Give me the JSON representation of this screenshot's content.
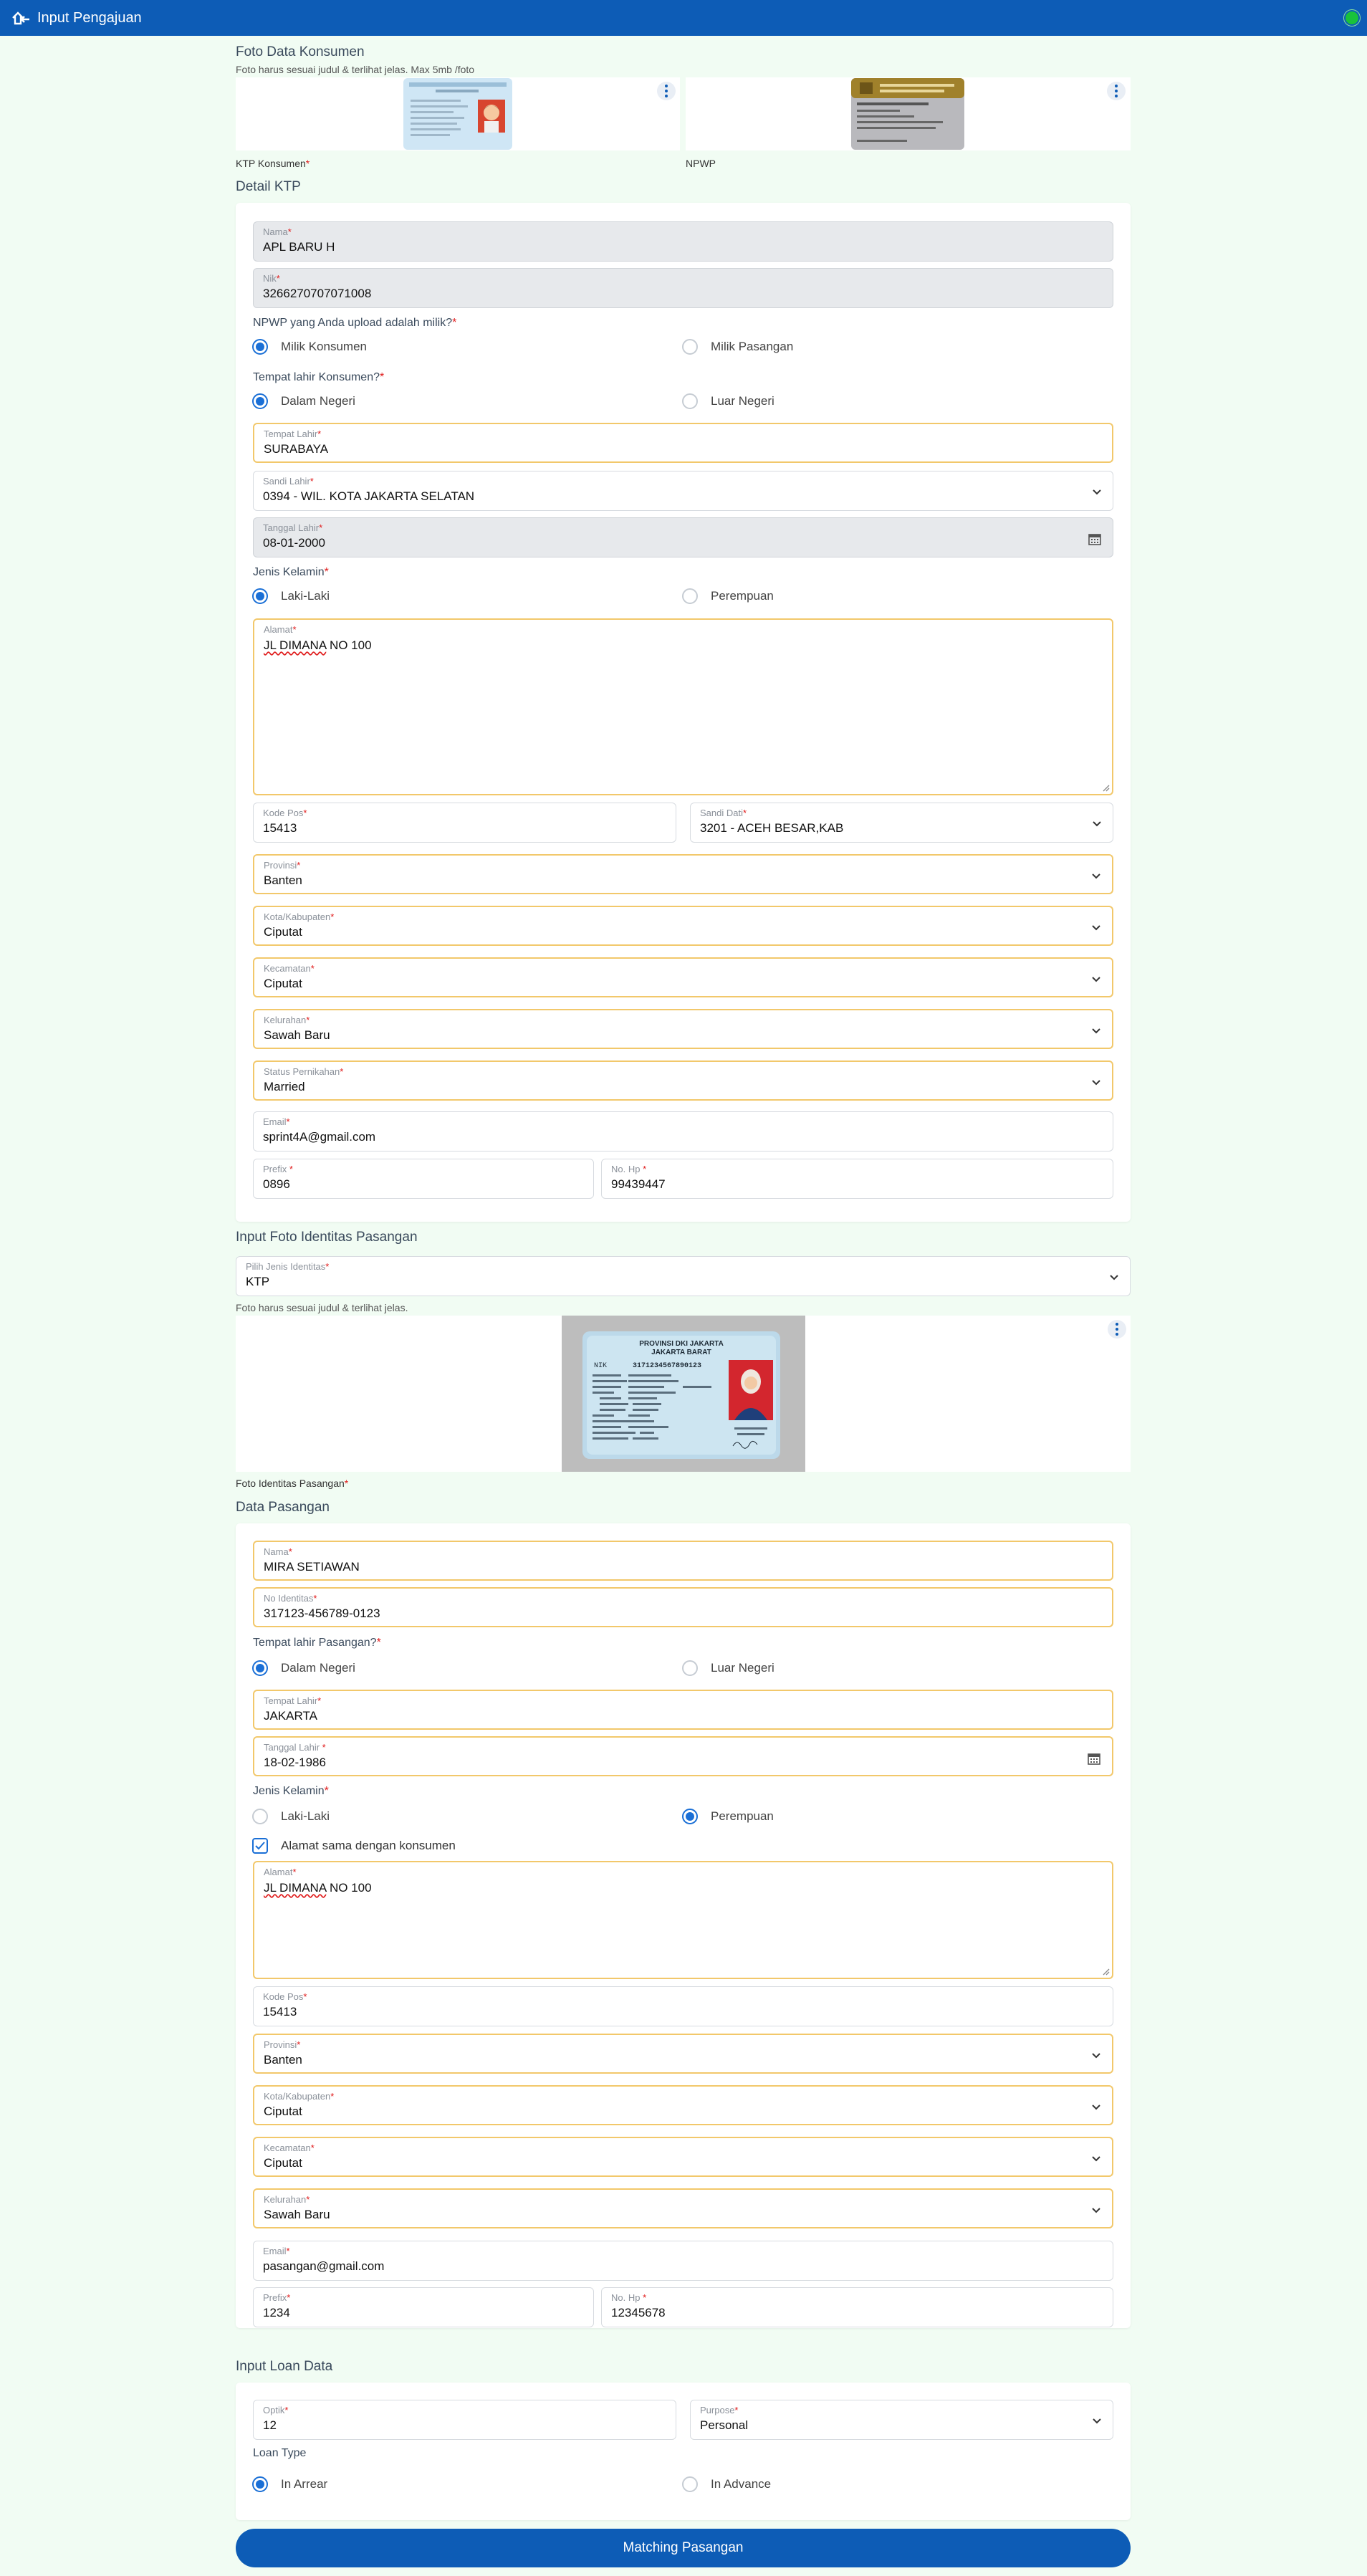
{
  "appbar": {
    "title": "Input Pengajuan"
  },
  "foto_konsumen": {
    "title": "Foto Data Konsumen",
    "hint": "Foto harus sesuai judul & terlihat jelas. Max 5mb /foto",
    "ktp_caption": "KTP Konsumen",
    "npwp_caption": "NPWP"
  },
  "detail_ktp": {
    "title": "Detail KTP",
    "nama": {
      "label": "Nama",
      "value": "APL BARU H"
    },
    "nik": {
      "label": "Nik",
      "value": "3266270707071008"
    },
    "npwp_question": "NPWP yang Anda upload adalah milik?",
    "npwp_options": [
      "Milik Konsumen",
      "Milik Pasangan"
    ],
    "tempat_question": "Tempat lahir Konsumen?",
    "tempat_options": [
      "Dalam Negeri",
      "Luar Negeri"
    ],
    "tempat_lahir": {
      "label": "Tempat Lahir",
      "value": "SURABAYA"
    },
    "sandi_lahir": {
      "label": "Sandi Lahir",
      "value": "0394 - WIL. KOTA JAKARTA SELATAN"
    },
    "tanggal_lahir": {
      "label": "Tanggal Lahir",
      "value": "08-01-2000"
    },
    "jk_question": "Jenis Kelamin",
    "jk_options": [
      "Laki-Laki",
      "Perempuan"
    ],
    "alamat": {
      "label": "Alamat",
      "value_a": "JL DIMANA",
      "value_b": " NO 100"
    },
    "kode_pos": {
      "label": "Kode Pos",
      "value": "15413"
    },
    "sandi_dati": {
      "label": "Sandi Dati",
      "value": "3201 - ACEH BESAR,KAB"
    },
    "provinsi": {
      "label": "Provinsi",
      "value": "Banten"
    },
    "kota": {
      "label": "Kota/Kabupaten",
      "value": "Ciputat"
    },
    "kecamatan": {
      "label": "Kecamatan",
      "value": "Ciputat"
    },
    "kelurahan": {
      "label": "Kelurahan",
      "value": "Sawah Baru"
    },
    "status": {
      "label": "Status Pernikahan",
      "value": "Married"
    },
    "email": {
      "label": "Email",
      "value": "sprint4A@gmail.com"
    },
    "prefix": {
      "label": "Prefix",
      "value": "0896"
    },
    "nohp": {
      "label": "No. Hp",
      "value": "99439447"
    }
  },
  "foto_pasangan": {
    "title": "Input Foto Identitas Pasangan",
    "jenis": {
      "label": "Pilih Jenis Identitas",
      "value": "KTP"
    },
    "hint": "Foto harus sesuai judul & terlihat jelas.",
    "caption": "Foto Identitas Pasangan",
    "card_title_1": "PROVINSI DKI JAKARTA",
    "card_title_2": "JAKARTA BARAT",
    "card_nik": "3171234567890123"
  },
  "data_pasangan": {
    "title": "Data Pasangan",
    "nama": {
      "label": "Nama",
      "value": "MIRA SETIAWAN"
    },
    "no_id": {
      "label": "No Identitas",
      "value": "317123-456789-0123"
    },
    "tempat_question": "Tempat lahir Pasangan?",
    "tempat_options": [
      "Dalam Negeri",
      "Luar Negeri"
    ],
    "tempat_lahir": {
      "label": "Tempat Lahir",
      "value": "JAKARTA"
    },
    "tanggal_lahir": {
      "label": "Tanggal Lahir",
      "value": "18-02-1986"
    },
    "jk_question": "Jenis Kelamin",
    "jk_options": [
      "Laki-Laki",
      "Perempuan"
    ],
    "same_address": "Alamat sama dengan konsumen",
    "alamat": {
      "label": "Alamat",
      "value_a": "JL DIMANA",
      "value_b": " NO 100"
    },
    "kode_pos": {
      "label": "Kode Pos",
      "value": "15413"
    },
    "provinsi": {
      "label": "Provinsi",
      "value": "Banten"
    },
    "kota": {
      "label": "Kota/Kabupaten",
      "value": "Ciputat"
    },
    "kecamatan": {
      "label": "Kecamatan",
      "value": "Ciputat"
    },
    "kelurahan": {
      "label": "Kelurahan",
      "value": "Sawah Baru"
    },
    "email": {
      "label": "Email",
      "value": "pasangan@gmail.com"
    },
    "prefix": {
      "label": "Prefix",
      "value": "1234"
    },
    "nohp": {
      "label": "No. Hp",
      "value": "12345678"
    }
  },
  "loan": {
    "title": "Input Loan Data",
    "optik": {
      "label": "Optik",
      "value": "12"
    },
    "purpose": {
      "label": "Purpose",
      "value": "Personal"
    },
    "type_question": "Loan Type",
    "type_options": [
      "In Arrear",
      "In Advance"
    ]
  },
  "submit_label": "Matching Pasangan",
  "colors": {
    "primary": "#0d5cb6",
    "highlight_border": "#f2c86b",
    "background": "#f1fcf3",
    "required": "#e01b1b"
  }
}
